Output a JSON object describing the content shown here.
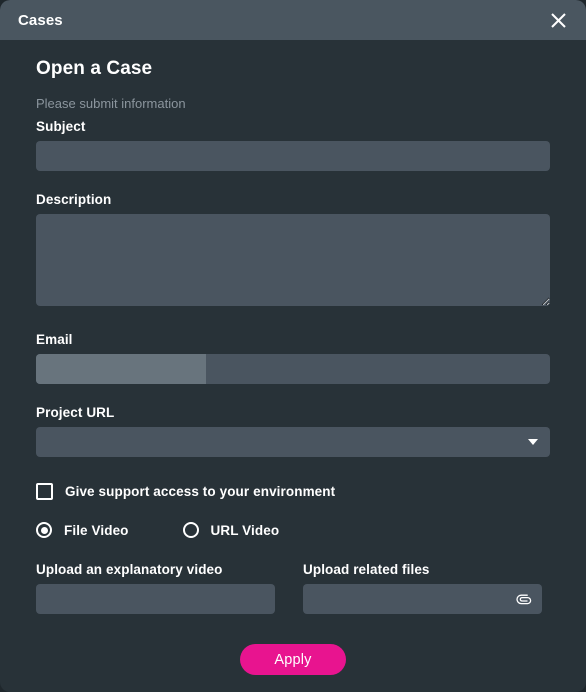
{
  "window": {
    "title": "Cases",
    "close_icon": "close-icon"
  },
  "form": {
    "heading": "Open a Case",
    "subtitle": "Please submit information",
    "fields": {
      "subject": {
        "label": "Subject",
        "value": "",
        "placeholder": ""
      },
      "description": {
        "label": "Description",
        "value": "",
        "placeholder": ""
      },
      "email": {
        "label": "Email",
        "value": "",
        "placeholder": "",
        "selection_highlight": true
      },
      "project_url": {
        "label": "Project URL",
        "value": "",
        "placeholder": "",
        "arrow_icon": "chevron-down-icon"
      }
    },
    "support_access": {
      "label": "Give support access to your environment",
      "checked": false
    },
    "video_source": {
      "options": [
        {
          "label": "File Video",
          "selected": true
        },
        {
          "label": "URL Video",
          "selected": false
        }
      ]
    },
    "uploads": {
      "video": {
        "label": "Upload an explanatory video",
        "value": ""
      },
      "files": {
        "label": "Upload related files",
        "value": "",
        "attach_icon": "paperclip-icon"
      }
    },
    "submit": {
      "label": "Apply"
    }
  },
  "colors": {
    "titlebar": "#4a5660",
    "dialog_background": "#283238",
    "input_background": "#4a5560",
    "selection_highlight": "#68747d",
    "accent": "#e8148f",
    "text_primary": "#ffffff",
    "text_muted": "#8b959d"
  }
}
